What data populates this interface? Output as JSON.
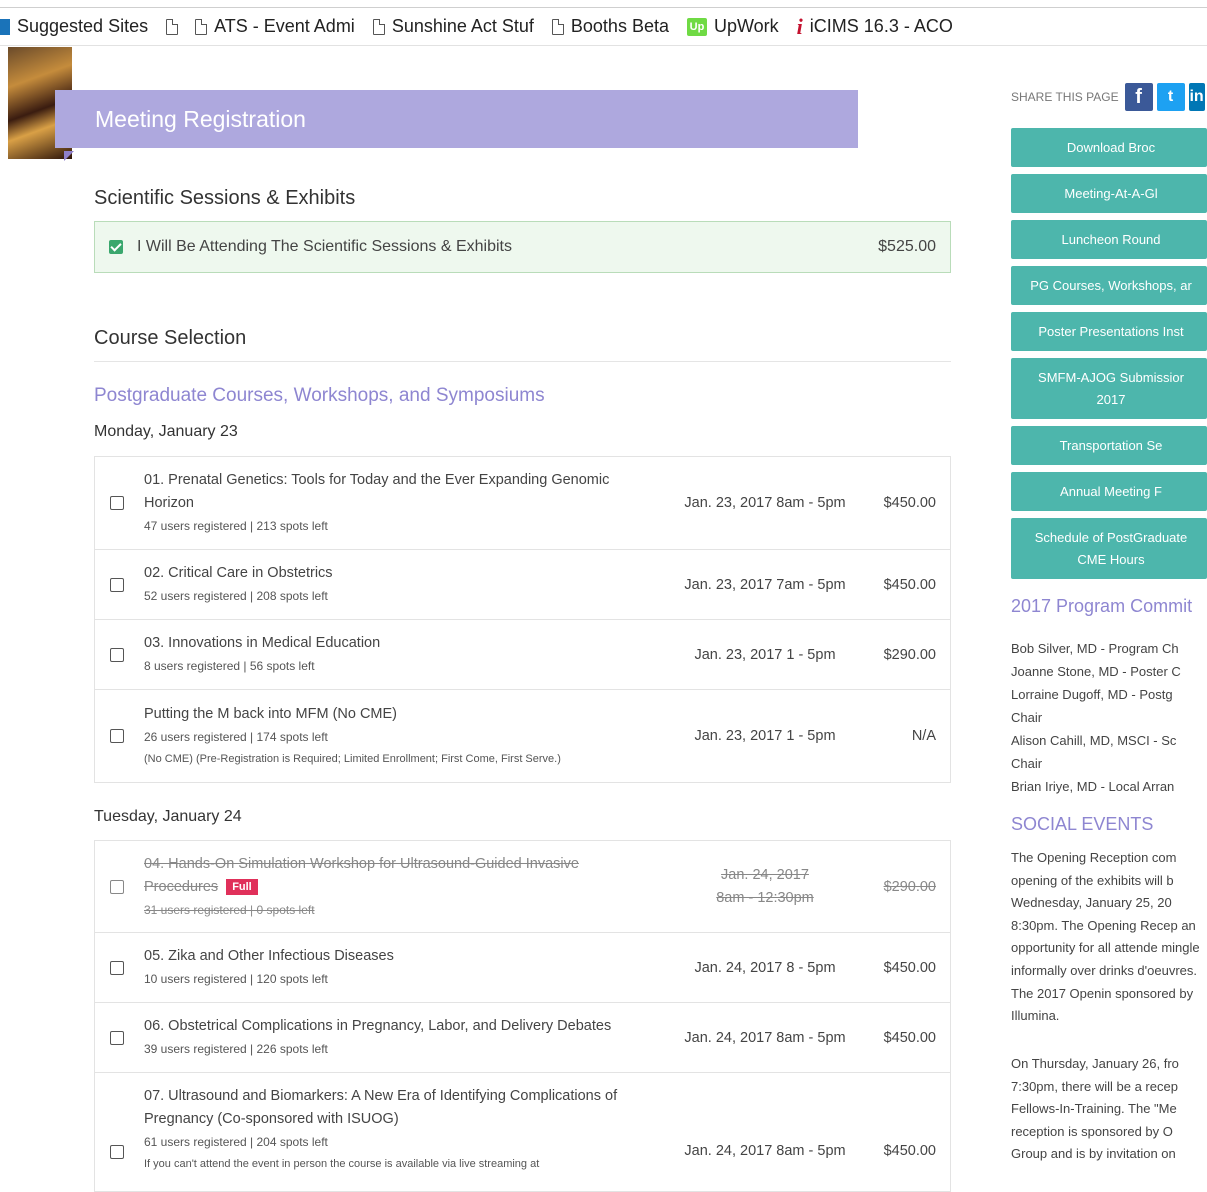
{
  "bookmarks": [
    {
      "label": "Suggested Sites",
      "icon": "ie-icon"
    },
    {
      "label": "",
      "icon": "document-icon"
    },
    {
      "label": "ATS - Event Admi",
      "icon": "document-icon"
    },
    {
      "label": "Sunshine Act Stuf",
      "icon": "document-icon"
    },
    {
      "label": "Booths Beta",
      "icon": "document-icon"
    },
    {
      "label": "UpWork",
      "icon": "upwork-icon"
    },
    {
      "label": "iCIMS 16.3 - ACO",
      "icon": "icims-icon"
    }
  ],
  "banner": {
    "title": "Meeting Registration"
  },
  "sessions": {
    "heading": "Scientific Sessions & Exhibits",
    "attend_label": "I Will Be Attending The Scientific Sessions & Exhibits",
    "attend_price": "$525.00",
    "attend_checked": true
  },
  "course_selection": {
    "heading": "Course Selection",
    "subheading": "Postgraduate Courses, Workshops, and Symposiums"
  },
  "days": [
    {
      "label": "Monday, January 23",
      "courses": [
        {
          "title": "01. Prenatal Genetics: Tools for Today and the Ever Expanding Genomic Horizon",
          "meta": "47 users registered | 213 spots left",
          "date": "Jan. 23, 2017 8am - 5pm",
          "price": "$450.00"
        },
        {
          "title": "02. Critical Care in Obstetrics",
          "meta": "52 users registered | 208 spots left",
          "date": "Jan. 23, 2017 7am - 5pm",
          "price": "$450.00"
        },
        {
          "title": "03. Innovations in Medical Education",
          "meta": "8 users registered | 56 spots left",
          "date": "Jan. 23, 2017 1 - 5pm",
          "price": "$290.00"
        },
        {
          "title": "Putting the M back into MFM (No CME)",
          "meta": "26 users registered | 174 spots left",
          "note": "(No CME) (Pre-Registration is Required; Limited Enrollment; First Come, First Serve.)",
          "date": "Jan. 23, 2017 1 - 5pm",
          "price": "N/A"
        }
      ]
    },
    {
      "label": "Tuesday, January 24",
      "courses": [
        {
          "title": "04. Hands-On Simulation Workshop for Ultrasound-Guided Invasive Procedures",
          "badge": "Full",
          "meta": "31 users registered | 0 spots left",
          "date": "Jan. 24, 2017 8am - 12:30pm",
          "price": "$290.00",
          "full": true
        },
        {
          "title": "05. Zika and Other Infectious Diseases",
          "meta": "10 users registered | 120 spots left",
          "date": "Jan. 24, 2017 8 - 5pm",
          "price": "$450.00"
        },
        {
          "title": "06. Obstetrical Complications in Pregnancy, Labor, and Delivery Debates",
          "meta": "39 users registered | 226 spots left",
          "date": "Jan. 24, 2017 8am - 5pm",
          "price": "$450.00"
        },
        {
          "title": "07. Ultrasound and Biomarkers: A New Era of Identifying Complications of Pregnancy (Co-sponsored with ISUOG)",
          "meta": "61 users registered | 204 spots left",
          "note": "If you can't attend the event in person the course is available via live streaming at",
          "date": "Jan. 24, 2017 8am - 5pm",
          "price": "$450.00"
        }
      ]
    }
  ],
  "sidebar": {
    "share_label": "SHARE THIS PAGE",
    "buttons": [
      "Download Broc",
      "Meeting-At-A-Gl",
      "Luncheon Round",
      "PG Courses, Workshops, ar",
      "Poster Presentations Inst",
      "SMFM-AJOG Submissior\n2017",
      "Transportation Se",
      "Annual Meeting F",
      "Schedule of PostGraduate\nCME Hours"
    ],
    "committee_heading": "2017 Program Commit",
    "committee": [
      "Bob Silver, MD - Program Ch",
      "Joanne Stone, MD - Poster C",
      "Lorraine Dugoff, MD - Postg",
      "Chair",
      "Alison Cahill, MD, MSCI - Sc",
      "Chair",
      "Brian Iriye, MD - Local Arran"
    ],
    "social_heading": "SOCIAL EVENTS",
    "social_p1": "The Opening Reception com opening of the exhibits will b Wednesday, January 25, 20 8:30pm. The Opening Recep an opportunity for all attende mingle informally over drinks d'oeuvres. The 2017 Openin sponsored by Illumina.",
    "social_p2": "On Thursday, January 26, fro 7:30pm, there will be a recep Fellows-In-Training. The \"Me reception is sponsored by O Group and is by invitation on"
  }
}
